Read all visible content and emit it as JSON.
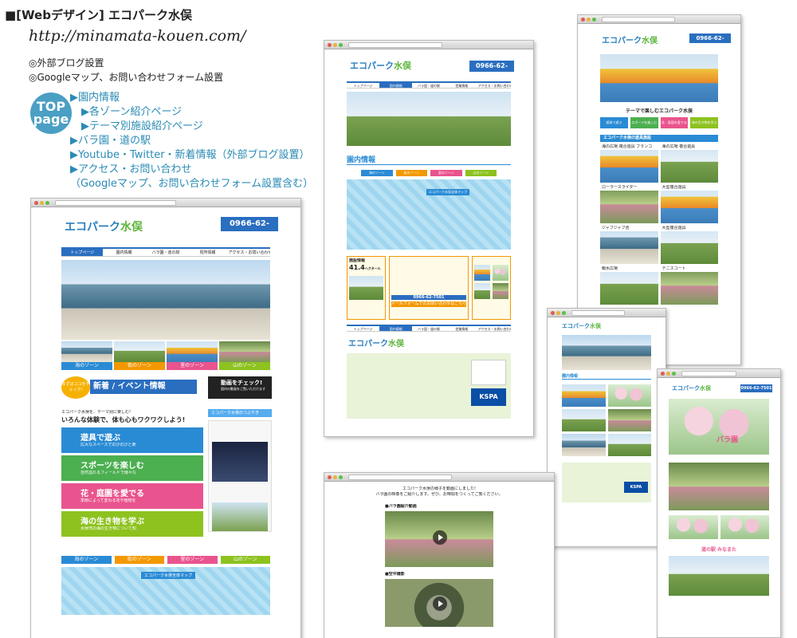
{
  "header": {
    "title": "■[Webデザイン] エコパーク水俣",
    "url": "http://minamata-kouen.com/",
    "features": [
      "◎外部ブログ設置",
      "◎Googleマップ、お問い合わせフォーム設置"
    ]
  },
  "top_badge": {
    "line1": "TOP",
    "line2": "page"
  },
  "top_list": [
    "▶園内情報",
    "  ▶各ゾーン紹介ページ",
    "  ▶テーマ別施設紹介ページ",
    "▶バラ園・道の駅",
    "▶Youtube・Twitter・新着情報（外部ブログ設置）",
    "▶アクセス・お問い合わせ",
    "（Googleマップ、お問い合わせフォーム設置含む）"
  ],
  "site": {
    "logo_main": "エコパーク",
    "logo_accent": "水俣",
    "phone": "0966-62-7501",
    "nav": [
      "トップページ",
      "園内情報",
      "バラ園・道の駅",
      "見所情報",
      "アクセス・お問い合わせ"
    ],
    "nav_short": [
      "トップページ",
      "園内情報",
      "バラ園・道の駅",
      "営業情報",
      "アクセス・お問い合わせ"
    ],
    "zones": [
      "海のゾーン",
      "街のゾーン",
      "里のゾーン",
      "山のゾーン"
    ],
    "news_badge": "まずはココをチェック!",
    "news_title": "新着 / イベント情報",
    "video_title": "動画をチェック!",
    "video_sub": "園内の動画をご覧いただけます",
    "twitter_label": "エコパーク水俣のつぶやき",
    "catch_small": "エコパーク水俣を、テーマ別に楽しむ!",
    "catch_big": "いろんな体験で、体も心もワクワクしよう!",
    "themes": [
      {
        "title": "遊具で遊ぶ",
        "desc": "広大なスペースでのびのびと楽しく遊ぼう"
      },
      {
        "title": "スポーツを楽しむ",
        "desc": "自然溢れるフィールドで様々なスポーツを楽しめます"
      },
      {
        "title": "花・庭園を愛でる",
        "desc": "季節によって変わる花や植物を身近で感じられます"
      },
      {
        "title": "海の生き物を学ぶ",
        "desc": "水俣湾の海の生き物について知ることができます"
      }
    ],
    "map_label": "エコパーク水俣全体マップ",
    "garden_heading": "園内情報",
    "theme_heading": "テーマで楽しむエコパーク水俣",
    "theme_buttons": [
      "遊具で遊ぶ",
      "スポーツを楽しむ",
      "花・庭園を愛でる",
      "海の生き物を学ぶ"
    ],
    "facility_bar": "エコパーク水俣の遊具施設",
    "facilities": [
      "海の広場 複合遊具 ブランコ",
      "海の広場 複合遊具",
      "ローラースライダー",
      "大型複合遊具",
      "ジャブジャブ池",
      "大型複合遊具",
      "親水広場",
      "テニスコート"
    ],
    "facility_bar2": "エコパーク水俣 バラ園",
    "rose_title": "バラ園",
    "area_title": "施設情報",
    "area_value": "41.4",
    "area_unit": "ヘクタール",
    "bottom_tel": "0966-62-7501",
    "mail_btn": "メールフォームでのお問い合わせはこちら",
    "kspa": "KSPA",
    "blog_intro": "エコパーク水俣の様子を動画にしました!",
    "blog_sub": "バラ園の映像をご紹介します。ぜひ、お時間をつくってご覧ください。",
    "blog_cat1": "■バラ園紹介動画",
    "blog_cat2": "■空中撮影",
    "michinoeki": "道の駅 みなまた"
  }
}
